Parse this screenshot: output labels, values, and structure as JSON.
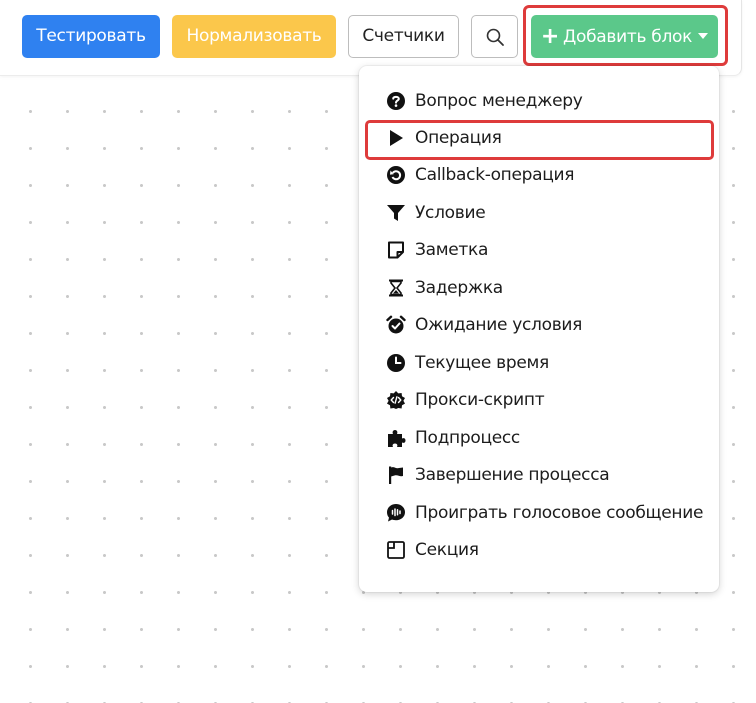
{
  "toolbar": {
    "test_label": "Тестировать",
    "normalize_label": "Нормализовать",
    "counters_label": "Счетчики",
    "add_block_label": "Добавить блок"
  },
  "colors": {
    "test": "#2f81f0",
    "normalize": "#fbc74b",
    "add_block": "#5bc88a",
    "highlight": "#de3b3b"
  },
  "menu": {
    "items": [
      {
        "label": "Вопрос менеджеру",
        "icon": "question-circle-icon"
      },
      {
        "label": "Операция",
        "icon": "play-icon"
      },
      {
        "label": "Callback-операция",
        "icon": "callback-arrow-icon"
      },
      {
        "label": "Условие",
        "icon": "filter-funnel-icon"
      },
      {
        "label": "Заметка",
        "icon": "sticky-note-icon"
      },
      {
        "label": "Задержка",
        "icon": "hourglass-icon"
      },
      {
        "label": "Ожидание условия",
        "icon": "alarm-clock-icon"
      },
      {
        "label": "Текущее время",
        "icon": "clock-icon"
      },
      {
        "label": "Прокси-скрипт",
        "icon": "code-gear-icon"
      },
      {
        "label": "Подпроцесс",
        "icon": "puzzle-piece-icon"
      },
      {
        "label": "Завершение процесса",
        "icon": "flag-icon"
      },
      {
        "label": "Проиграть голосовое сообщение",
        "icon": "voice-message-icon"
      },
      {
        "label": "Секция",
        "icon": "section-frame-icon"
      }
    ]
  }
}
